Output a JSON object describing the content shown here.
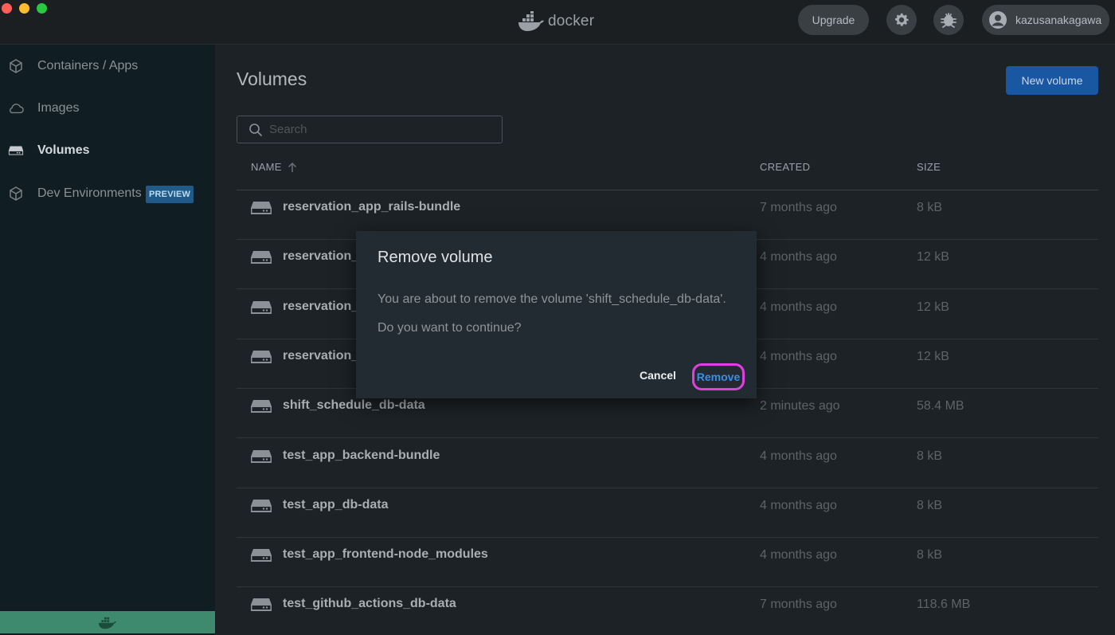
{
  "header": {
    "logo_text": "docker",
    "upgrade_label": "Upgrade",
    "username": "kazusanakagawa"
  },
  "sidebar": {
    "items": [
      {
        "label": "Containers / Apps",
        "icon": "container-icon"
      },
      {
        "label": "Images",
        "icon": "cloud-icon"
      },
      {
        "label": "Volumes",
        "icon": "disk-icon",
        "active": true
      },
      {
        "label": "Dev Environments",
        "icon": "cube-icon",
        "badge": "PREVIEW"
      }
    ]
  },
  "main": {
    "title": "Volumes",
    "new_volume_label": "New volume",
    "search_placeholder": "Search",
    "columns": {
      "name": "NAME",
      "created": "CREATED",
      "size": "SIZE"
    },
    "rows": [
      {
        "name": "reservation_app_rails-bundle",
        "created": "7 months ago",
        "size": "8 kB"
      },
      {
        "name": "reservation_",
        "created": "4 months ago",
        "size": "12 kB"
      },
      {
        "name": "reservation_",
        "created": "4 months ago",
        "size": "12 kB"
      },
      {
        "name": "reservation_",
        "created": "4 months ago",
        "size": "12 kB"
      },
      {
        "name": "shift_schedule_db-data",
        "created": "2 minutes ago",
        "size": "58.4 MB"
      },
      {
        "name": "test_app_backend-bundle",
        "created": "4 months ago",
        "size": "8 kB"
      },
      {
        "name": "test_app_db-data",
        "created": "4 months ago",
        "size": "8 kB"
      },
      {
        "name": "test_app_frontend-node_modules",
        "created": "4 months ago",
        "size": "8 kB"
      },
      {
        "name": "test_github_actions_db-data",
        "created": "7 months ago",
        "size": "118.6 MB"
      }
    ]
  },
  "dialog": {
    "title": "Remove volume",
    "message": "You are about to remove the volume 'shift_schedule_db-data'.",
    "question": "Do you want to continue?",
    "cancel_label": "Cancel",
    "remove_label": "Remove"
  },
  "colors": {
    "accent_blue": "#1a57a3",
    "sidebar_bg": "#101d22",
    "footer_green": "#3d8a6f",
    "highlight_magenta": "#e23fe3"
  }
}
